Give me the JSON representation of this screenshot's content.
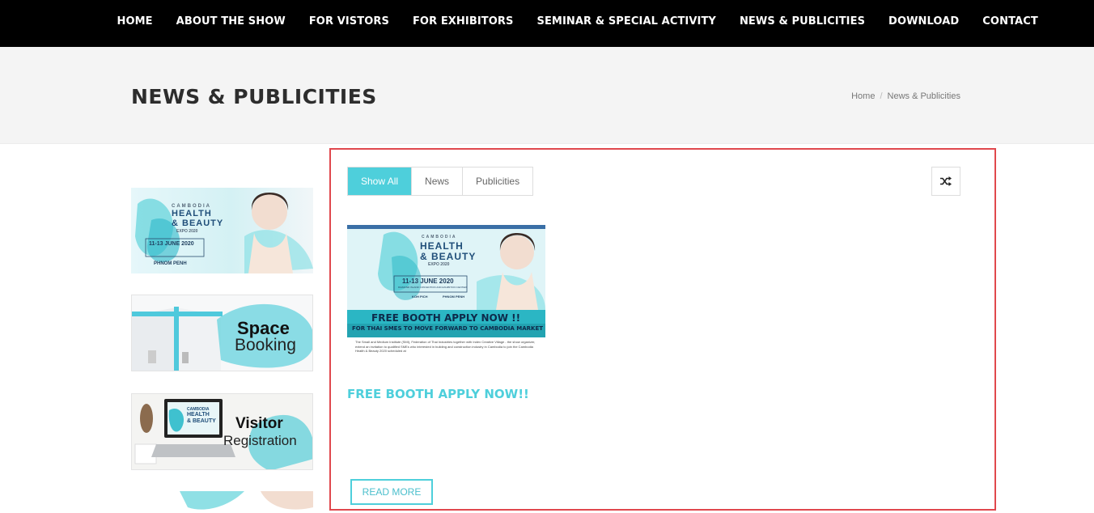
{
  "nav": {
    "items": [
      "HOME",
      "ABOUT THE SHOW",
      "FOR VISTORS",
      "FOR EXHIBITORS",
      "SEMINAR & SPECIAL ACTIVITY",
      "NEWS & PUBLICITIES",
      "DOWNLOAD",
      "CONTACT"
    ]
  },
  "hero": {
    "title": "NEWS & PUBLICITIES",
    "breadcrumb": {
      "home": "Home",
      "separator": "/",
      "current": "News & Publicities"
    }
  },
  "sidebar": {
    "banner1": {
      "line1": "CAMBODIA",
      "line2": "HEALTH",
      "line3": "& BEAUTY",
      "line4": "EXPO 2020",
      "date": "11-13 JUNE 2020",
      "city": "PHNOM PENH"
    },
    "banner2": {
      "line1": "Space",
      "line2": "Booking"
    },
    "banner3": {
      "line1": "Visitor",
      "line2": "Registration",
      "screen1": "CAMBODIA",
      "screen2": "HEALTH",
      "screen3": "& BEAUTY"
    }
  },
  "filters": [
    "Show All",
    "News",
    "Publicities"
  ],
  "shuffle_icon": "shuffle-icon",
  "card": {
    "image": {
      "line1": "CAMBODIA",
      "line2": "HEALTH",
      "line3": "& BEAUTY",
      "line4": "EXPO 2020",
      "date": "11-13 JUNE 2020",
      "venue": "DIAMOND ISLAND CONVENTION AND EXHIBITION CENTER",
      "koh": "KOH PICH",
      "city": "PHNOM PENH",
      "headline": "FREE BOOTH APPLY NOW !!",
      "subline": "FOR THAI SMES TO MOVE FORWARD TO CAMBODIA MARKET",
      "body": "The Small and Medium Institute (SMI), Federation of Thai Industries together with Index Creative Village - the show organizer, extend an invitation to qualified SMEs who interested in building and construction industry in Cambodia to join the Cambodia Health & Beauty 2020 scheduled at"
    },
    "title": "FREE BOOTH APPLY NOW!!",
    "read_more": "READ MORE"
  },
  "colors": {
    "accent": "#4ecfdb",
    "nav_bg": "#000000",
    "highlight_border": "#e0484d"
  }
}
